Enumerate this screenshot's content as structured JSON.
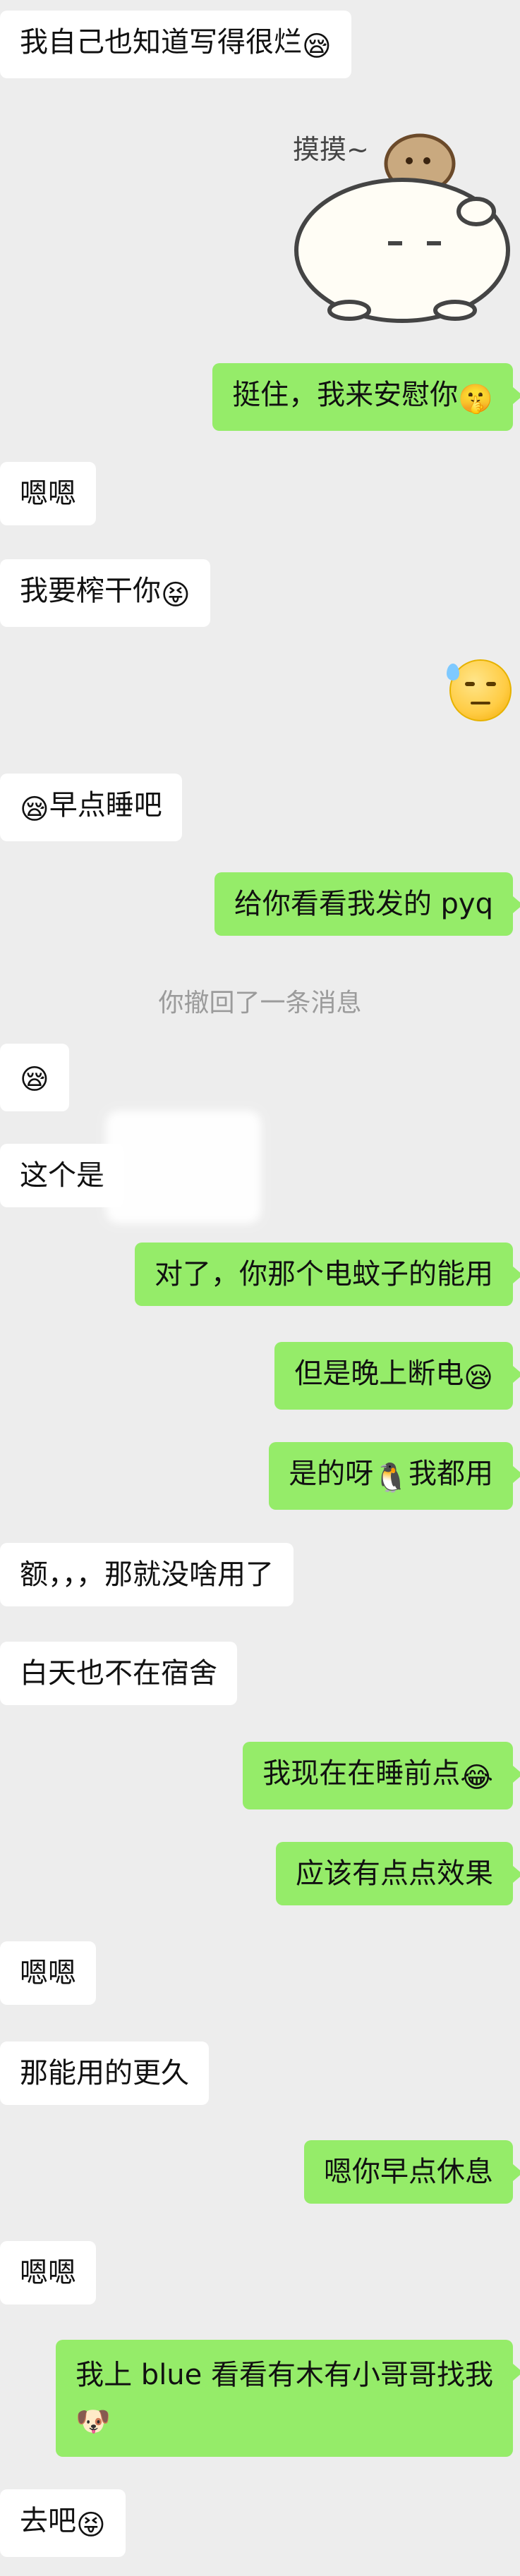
{
  "messages": [
    {
      "side": "left",
      "text": "我自己也知道写得很烂",
      "emoji": "😪"
    },
    {
      "side": "right",
      "text": "挺住，我来安慰你",
      "emoji": "🤫"
    },
    {
      "side": "left",
      "text": "嗯嗯",
      "emoji": ""
    },
    {
      "side": "left",
      "text": "我要榨干你",
      "emoji": "😝"
    },
    {
      "side": "left",
      "text": "早点睡吧",
      "emoji_before": "😪"
    },
    {
      "side": "right",
      "text": "给你看看我发的 pyq",
      "emoji": ""
    },
    {
      "side": "left",
      "text": "",
      "emoji": "😪"
    },
    {
      "side": "left",
      "text": "这个是",
      "emoji": ""
    },
    {
      "side": "right",
      "text": "对了，你那个电蚊子的能用",
      "emoji": ""
    },
    {
      "side": "right",
      "text": "但是晚上断电",
      "emoji": "😪"
    },
    {
      "side": "right",
      "text": "是的呀",
      "emoji": "🐧",
      "text_after": "我都用"
    },
    {
      "side": "left",
      "text": "额，，，那就没啥用了",
      "emoji": ""
    },
    {
      "side": "left",
      "text": "白天也不在宿舍",
      "emoji": ""
    },
    {
      "side": "right",
      "text": "我现在在睡前点",
      "emoji": "😂"
    },
    {
      "side": "right",
      "text": "应该有点点效果",
      "emoji": ""
    },
    {
      "side": "left",
      "text": "嗯嗯",
      "emoji": ""
    },
    {
      "side": "left",
      "text": "那能用的更久",
      "emoji": ""
    },
    {
      "side": "right",
      "text": "嗯你早点休息",
      "emoji": ""
    },
    {
      "side": "left",
      "text": "嗯嗯",
      "emoji": ""
    },
    {
      "side": "right",
      "text_line1": "我上 blue 看看有木有小哥哥找我",
      "emoji_line2": "🐶"
    },
    {
      "side": "left",
      "text": "去吧",
      "emoji": "😝"
    }
  ],
  "system": {
    "recall_text": "你撤回了一条消息"
  },
  "sticker": {
    "caption": "摸摸~"
  },
  "colors": {
    "background": "#ededed",
    "left_bubble": "#ffffff",
    "right_bubble": "#95ec69",
    "system_text": "#9b9b9b"
  }
}
